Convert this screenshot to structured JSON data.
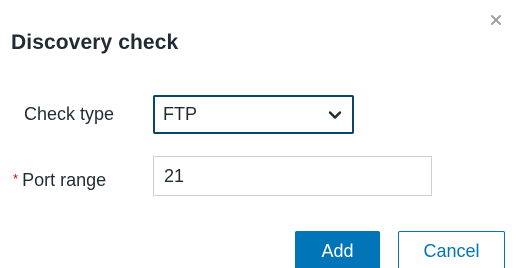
{
  "dialog": {
    "title": "Discovery check",
    "close_icon": "close-icon"
  },
  "form": {
    "check_type": {
      "label": "Check type",
      "selected": "FTP",
      "icon": "chevron-down-icon"
    },
    "port_range": {
      "required_marker": "*",
      "label": "Port range",
      "value": "21"
    }
  },
  "buttons": {
    "add_label": "Add",
    "cancel_label": "Cancel"
  },
  "colors": {
    "primary": "#0275b8",
    "select_border": "#0a466a",
    "required": "#d40000",
    "text": "#1f2c33"
  }
}
